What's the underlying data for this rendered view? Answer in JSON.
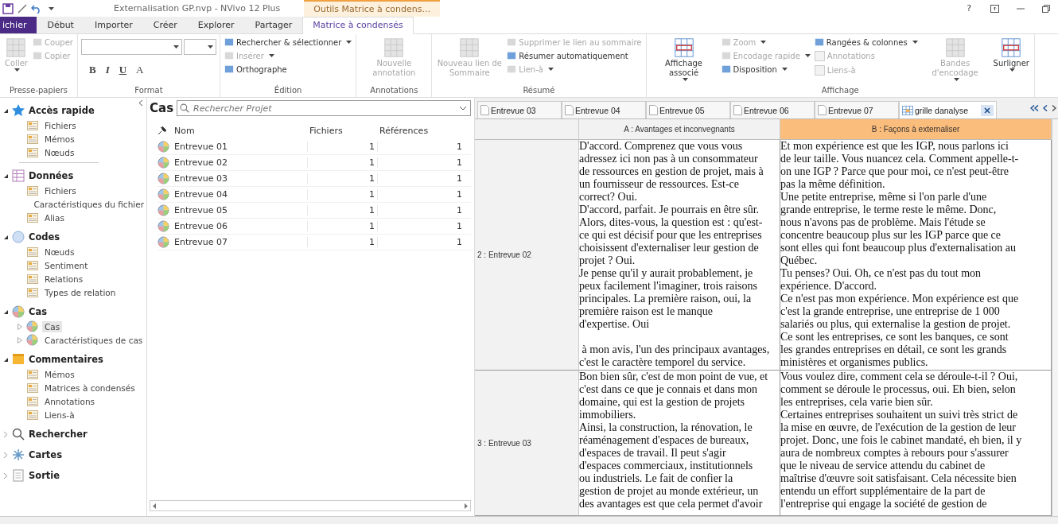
{
  "title_bar": {
    "title": "Externalisation GP.nvp - NVivo 12 Plus",
    "context_tab": "Outils Matrice à condens...",
    "help": "?"
  },
  "menu_tabs": [
    {
      "label": "ichier",
      "kind": "file",
      "selected": false
    },
    {
      "label": "Début",
      "kind": "tab",
      "selected": false
    },
    {
      "label": "Importer",
      "kind": "tab",
      "selected": false
    },
    {
      "label": "Créer",
      "kind": "tab",
      "selected": false
    },
    {
      "label": "Explorer",
      "kind": "tab",
      "selected": false
    },
    {
      "label": "Partager",
      "kind": "tab",
      "selected": false
    },
    {
      "label": "Matrice à condensés",
      "kind": "tab",
      "selected": true
    }
  ],
  "ribbon": {
    "groups": [
      {
        "label": "Presse-papiers",
        "columns": [
          [
            {
              "kind": "large",
              "label": "Coller",
              "disabled": true,
              "dropdown": true
            }
          ],
          [
            {
              "kind": "small",
              "label": "Couper",
              "disabled": true,
              "dropdown": false
            },
            {
              "kind": "small",
              "label": "Copier",
              "disabled": true,
              "dropdown": false
            }
          ]
        ]
      },
      {
        "label": "Format",
        "columns": [
          [
            {
              "kind": "combos"
            },
            {
              "kind": "format",
              "buttons": [
                "B",
                "I",
                "U",
                "A"
              ]
            }
          ]
        ]
      },
      {
        "label": "Édition",
        "columns": [
          [
            {
              "kind": "small",
              "label": "Rechercher & sélectionner",
              "disabled": false,
              "dropdown": true
            },
            {
              "kind": "small",
              "label": "Insérer",
              "disabled": true,
              "dropdown": true
            },
            {
              "kind": "small",
              "label": "Orthographe",
              "disabled": false,
              "dropdown": false
            }
          ]
        ]
      },
      {
        "label": "Annotations",
        "columns": [
          [
            {
              "kind": "large",
              "label": "Nouvelle annotation",
              "disabled": true,
              "dropdown": false
            }
          ]
        ]
      },
      {
        "label": "Résumé",
        "columns": [
          [
            {
              "kind": "large",
              "label": "Nouveau lien de Sommaire",
              "disabled": true,
              "dropdown": false
            }
          ],
          [
            {
              "kind": "small",
              "label": "Supprimer le lien au sommaire",
              "disabled": true,
              "dropdown": false
            },
            {
              "kind": "small",
              "label": "Résumer automatiquement",
              "disabled": false,
              "dropdown": false
            },
            {
              "kind": "small",
              "label": "Lien-à",
              "disabled": true,
              "dropdown": true
            }
          ]
        ]
      },
      {
        "label": "Affichage",
        "columns": [
          [
            {
              "kind": "large",
              "label": "Affichage associé",
              "disabled": false,
              "dropdown": true
            }
          ],
          [
            {
              "kind": "small",
              "label": "Zoom",
              "disabled": true,
              "dropdown": true
            },
            {
              "kind": "small",
              "label": "Encodage rapide",
              "disabled": true,
              "dropdown": true
            },
            {
              "kind": "small",
              "label": "Disposition",
              "disabled": false,
              "dropdown": true
            }
          ],
          [
            {
              "kind": "small",
              "label": "Rangées & colonnes",
              "disabled": false,
              "dropdown": true
            },
            {
              "kind": "checkbox",
              "label": "Annotations",
              "disabled": true,
              "checked": false
            },
            {
              "kind": "checkbox",
              "label": "Liens-à",
              "disabled": true,
              "checked": false
            }
          ],
          [
            {
              "kind": "large",
              "label": "Bandes d'encodage",
              "disabled": true,
              "dropdown": true
            }
          ],
          [
            {
              "kind": "large",
              "label": "Surligner",
              "disabled": false,
              "dropdown": true
            }
          ]
        ]
      }
    ]
  },
  "sidebar": {
    "sections": [
      {
        "label": "Accès rapide",
        "expanded": true,
        "items": [
          {
            "label": "Fichiers",
            "selected": false
          },
          {
            "label": "Mémos",
            "selected": false
          },
          {
            "label": "Nœuds",
            "selected": false
          }
        ]
      },
      {
        "label": "Données",
        "expanded": true,
        "items": [
          {
            "label": "Fichiers",
            "selected": false
          },
          {
            "label": "Caractéristiques du fichier",
            "selected": false
          },
          {
            "label": "Alias",
            "selected": false
          }
        ]
      },
      {
        "label": "Codes",
        "expanded": true,
        "items": [
          {
            "label": "Nœuds",
            "selected": false
          },
          {
            "label": "Sentiment",
            "selected": false
          },
          {
            "label": "Relations",
            "selected": false
          },
          {
            "label": "Types de relation",
            "selected": false
          }
        ]
      },
      {
        "label": "Cas",
        "expanded": true,
        "items": [
          {
            "label": "Cas",
            "selected": true,
            "expanded": false
          },
          {
            "label": "Caractéristiques de cas",
            "selected": false,
            "expanded": false
          }
        ]
      },
      {
        "label": "Commentaires",
        "expanded": true,
        "items": [
          {
            "label": "Mémos",
            "selected": false
          },
          {
            "label": "Matrices à condensés",
            "selected": false
          },
          {
            "label": "Annotations",
            "selected": false
          },
          {
            "label": "Liens-à",
            "selected": false
          }
        ]
      },
      {
        "label": "Rechercher",
        "expanded": false
      },
      {
        "label": "Cartes",
        "expanded": false
      },
      {
        "label": "Sortie",
        "expanded": false
      }
    ]
  },
  "list_panel": {
    "title": "Cas",
    "search": {
      "placeholder": "Rechercher Projet"
    },
    "columns": [
      "Nom",
      "Fichiers",
      "Références"
    ],
    "rows": [
      {
        "name": "Entrevue 01",
        "files": "1",
        "references": "1"
      },
      {
        "name": "Entrevue 02",
        "files": "1",
        "references": "1"
      },
      {
        "name": "Entrevue 03",
        "files": "1",
        "references": "1"
      },
      {
        "name": "Entrevue 04",
        "files": "1",
        "references": "1"
      },
      {
        "name": "Entrevue 05",
        "files": "1",
        "references": "1"
      },
      {
        "name": "Entrevue 06",
        "files": "1",
        "references": "1"
      },
      {
        "name": "Entrevue 07",
        "files": "1",
        "references": "1"
      }
    ]
  },
  "doc_tabs": [
    {
      "label": "Entrevue 03",
      "kind": "document",
      "selected": false
    },
    {
      "label": "Entrevue 04",
      "kind": "document",
      "selected": false
    },
    {
      "label": "Entrevue 05",
      "kind": "document",
      "selected": false
    },
    {
      "label": "Entrevue 06",
      "kind": "document",
      "selected": false
    },
    {
      "label": "Entrevue 07",
      "kind": "document",
      "selected": false
    },
    {
      "label": "grille danalyse",
      "kind": "matrix",
      "selected": true
    }
  ],
  "matrix": {
    "columns": [
      {
        "label": "A : Avantages et inconvegnants",
        "selected": false
      },
      {
        "label": "B : Façons à externaliser",
        "selected": true
      }
    ],
    "rows": [
      {
        "label": "2 : Entrevue 02",
        "cells": [
          [
            "D'accord. Comprenez que vous vous",
            "adressez ici non pas à un consommateur",
            "de ressources en gestion de projet, mais à",
            "un fournisseur de ressources. Est-ce",
            "correct? Oui.",
            "D'accord, parfait. Je pourrais en être sûr.",
            "Alors, dites-vous, la question est : qu'est-",
            "ce qui est décisif pour que les entreprises",
            "choisissent d'externaliser leur gestion de",
            "projet ? Oui.",
            "Je pense qu'il y aurait probablement, je",
            "peux facilement l'imaginer, trois raisons",
            "principales. La première raison, oui, la",
            "première raison est le manque",
            "d'expertise. Oui",
            "",
            " à mon avis, l'un des principaux avantages,",
            "c'est le caractère temporel du service."
          ],
          [
            "Et mon expérience est que les IGP, nous parlons ici",
            "de leur taille. Vous nuancez cela. Comment appelle-t-",
            "on une IGP ? Parce que pour moi, ce n'est peut-être",
            "pas la même définition.",
            "Une petite entreprise, même si l'on parle d'une",
            "grande entreprise, le terme reste le même. Donc,",
            "nous n'avons pas de problème. Mais l'étude se",
            "concentre beaucoup plus sur les IGP parce que ce",
            "sont elles qui font beaucoup plus d'externalisation au",
            "Québec.",
            "Tu penses? Oui. Oh, ce n'est pas du tout mon",
            "expérience. D'accord.",
            "Ce n'est pas mon expérience. Mon expérience est que",
            "c'est la grande entreprise, une entreprise de 1 000",
            "salariés ou plus, qui externalise la gestion de projet.",
            "Ce sont les entreprises, ce sont les banques, ce sont",
            "les grandes entreprises en détail, ce sont les grands",
            "ministères et organismes publics."
          ]
        ]
      },
      {
        "label": "3 : Entrevue 03",
        "cells": [
          [
            "Bon bien sûr, c'est de mon point de vue, et",
            "c'est dans ce que je connais et dans mon",
            "domaine, qui est la gestion de projets",
            "immobiliers.",
            "Ainsi, la construction, la rénovation, le",
            "réaménagement d'espaces de bureaux,",
            "d'espaces de travail. Il peut s'agir",
            "d'espaces commerciaux, institutionnels",
            "ou industriels. Le fait de confier la",
            "gestion de projet au monde extérieur, un",
            "des avantages est que cela permet d'avoir"
          ],
          [
            "Vous voulez dire, comment cela se déroule-t-il ? Oui,",
            "comment se déroule le processus, oui. Eh bien, selon",
            "les entreprises, cela varie bien sûr.",
            "Certaines entreprises souhaitent un suivi très strict de",
            "la mise en œuvre, de l'exécution de la gestion de leur",
            "projet. Donc, une fois le cabinet mandaté, eh bien, il y",
            "aura de nombreux comptes à rebours pour s'assurer",
            "que le niveau de service attendu du cabinet de",
            "maîtrise d'œuvre soit satisfaisant. Cela nécessite bien",
            "entendu un effort supplémentaire de la part de",
            "l'entreprise qui engage la société de gestion de"
          ]
        ]
      }
    ]
  }
}
